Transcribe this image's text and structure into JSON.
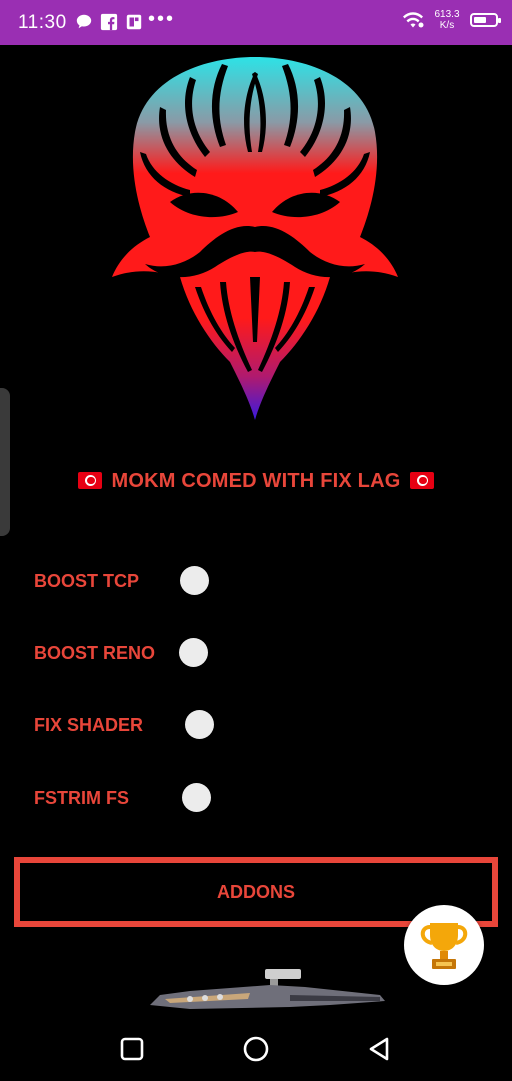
{
  "status_bar": {
    "time": "11:30",
    "notification_icons": [
      "chat-bubble-icon",
      "facebook-icon",
      "document-app-icon",
      "more-dots-icon"
    ],
    "network_speed_value": "613.3",
    "network_speed_unit": "K/s",
    "battery_level": 0.6
  },
  "app": {
    "headline": "MOKM COMED WITH FIX LAG",
    "toggles": [
      {
        "label": "BOOST TCP",
        "enabled": false
      },
      {
        "label": "BOOST RENO",
        "enabled": false
      },
      {
        "label": "FIX SHADER",
        "enabled": false
      },
      {
        "label": "FSTRIM FS",
        "enabled": false
      }
    ],
    "addons_label": "ADDONS",
    "accent_color": "#e8463a",
    "status_bar_color": "#9a2fb3"
  },
  "nav": {
    "buttons": [
      "recents-square-icon",
      "home-circle-icon",
      "back-triangle-icon"
    ]
  }
}
